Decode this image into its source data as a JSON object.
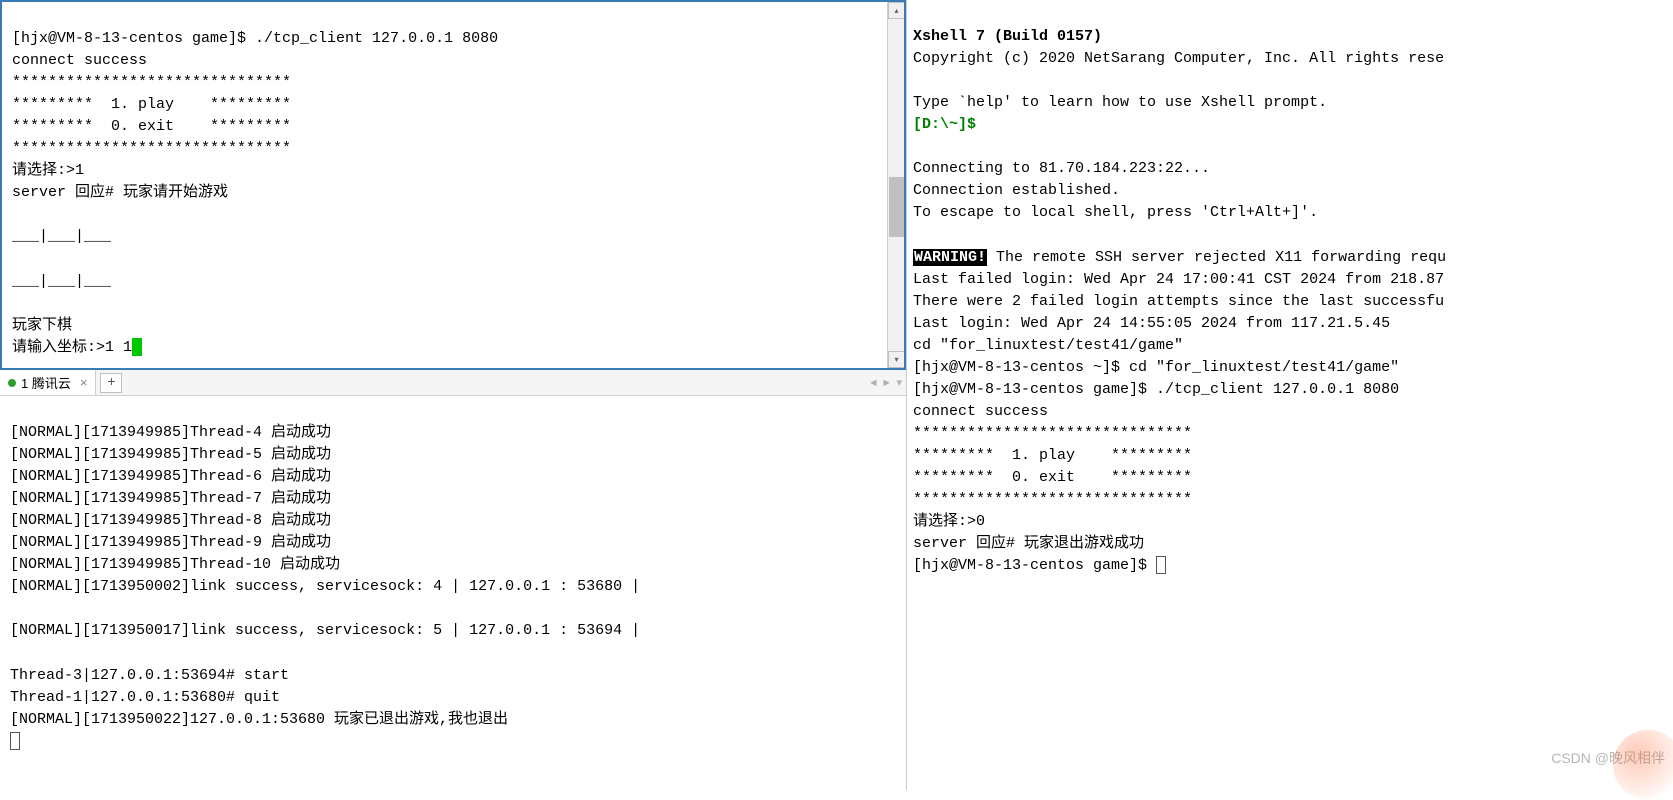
{
  "left_top": {
    "lines": [
      "[hjx@VM-8-13-centos game]$ ./tcp_client 127.0.0.1 8080",
      "connect success",
      "*******************************",
      "*********  1. play    *********",
      "*********  0. exit    *********",
      "*******************************",
      "请选择:>1",
      "server 回应# 玩家请开始游戏",
      "",
      "___|___|___",
      "",
      "___|___|___",
      "",
      "玩家下棋",
      "请输入坐标:>1 1"
    ]
  },
  "tabbar": {
    "tab_label": "1 腾讯云",
    "close": "×",
    "add": "+",
    "nav": "◄  ►  ▾"
  },
  "left_bottom": {
    "lines": [
      "[NORMAL][1713949985]Thread-4 启动成功",
      "[NORMAL][1713949985]Thread-5 启动成功",
      "[NORMAL][1713949985]Thread-6 启动成功",
      "[NORMAL][1713949985]Thread-7 启动成功",
      "[NORMAL][1713949985]Thread-8 启动成功",
      "[NORMAL][1713949985]Thread-9 启动成功",
      "[NORMAL][1713949985]Thread-10 启动成功",
      "[NORMAL][1713950002]link success, servicesock: 4 | 127.0.0.1 : 53680 |",
      "",
      "[NORMAL][1713950017]link success, servicesock: 5 | 127.0.0.1 : 53694 |",
      "",
      "Thread-3|127.0.0.1:53694# start",
      "Thread-1|127.0.0.1:53680# quit",
      "[NORMAL][1713950022]127.0.0.1:53680 玩家已退出游戏,我也退出"
    ]
  },
  "right": {
    "title": "Xshell 7 (Build 0157)",
    "copyright": "Copyright (c) 2020 NetSarang Computer, Inc. All rights rese",
    "help_line": "Type `help' to learn how to use Xshell prompt.",
    "prompt": "[D:\\~]$",
    "connecting": "Connecting to 81.70.184.223:22...",
    "established": "Connection established.",
    "escape": "To escape to local shell, press 'Ctrl+Alt+]'.",
    "warning_label": "WARNING!",
    "warning_rest": " The remote SSH server rejected X11 forwarding requ",
    "last_failed": "Last failed login: Wed Apr 24 17:00:41 CST 2024 from 218.87",
    "attempts": "There were 2 failed login attempts since the last successfu",
    "last_login": "Last login: Wed Apr 24 14:55:05 2024 from 117.21.5.45",
    "cd_line": "cd \"for_linuxtest/test41/game\"",
    "prompt_cd": "[hjx@VM-8-13-centos ~]$ cd \"for_linuxtest/test41/game\"",
    "prompt_run": "[hjx@VM-8-13-centos game]$ ./tcp_client 127.0.0.1 8080",
    "connect_success": "connect success",
    "stars1": "*******************************",
    "play": "*********  1. play    *********",
    "exit": "*********  0. exit    *********",
    "stars2": "*******************************",
    "select": "请选择:>0",
    "server_resp": "server 回应# 玩家退出游戏成功",
    "final_prompt": "[hjx@VM-8-13-centos game]$ "
  },
  "watermark": "CSDN @晚风相伴"
}
